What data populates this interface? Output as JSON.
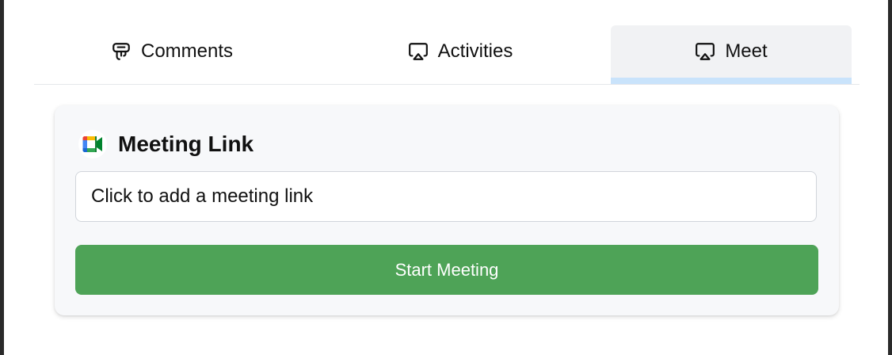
{
  "tabs": [
    {
      "label": "Comments",
      "icon": "comments-icon",
      "active": false
    },
    {
      "label": "Activities",
      "icon": "airplay-icon",
      "active": false
    },
    {
      "label": "Meet",
      "icon": "airplay-icon",
      "active": true
    }
  ],
  "meeting": {
    "title": "Meeting Link",
    "logo": "google-meet-logo",
    "link_placeholder": "Click to add a meeting link",
    "link_value": "",
    "start_button_label": "Start Meeting"
  },
  "colors": {
    "active_tab_bg": "#f1f2f4",
    "active_tab_indicator": "#c9e3fb",
    "start_button": "#4ea357",
    "card_bg": "#f7f8fa"
  }
}
